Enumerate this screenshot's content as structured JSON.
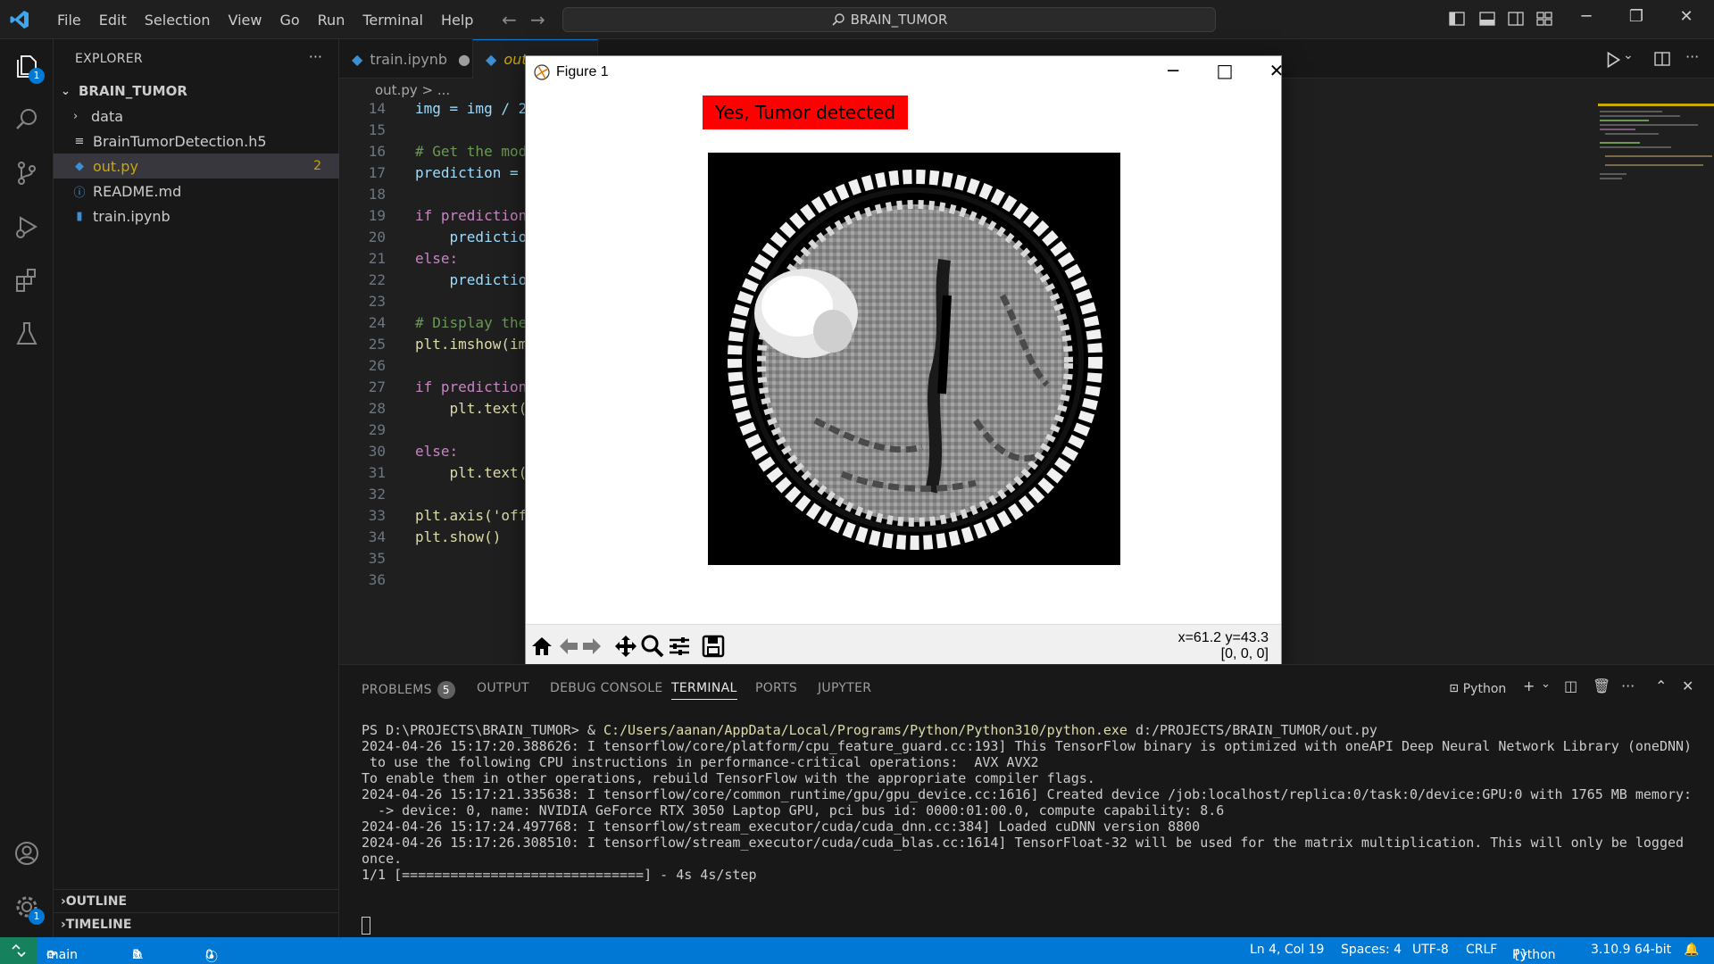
{
  "titlebar": {
    "menu": [
      "File",
      "Edit",
      "Selection",
      "View",
      "Go",
      "Run",
      "Terminal",
      "Help"
    ],
    "search_text": "BRAIN_TUMOR"
  },
  "activity": {
    "explorer_badge": "1",
    "settings_badge": "1"
  },
  "explorer": {
    "header": "EXPLORER",
    "more": "···",
    "root": "BRAIN_TUMOR",
    "items": [
      {
        "label": "data",
        "icon": "folder-chevron-icon"
      },
      {
        "label": "BrainTumorDetection.h5",
        "icon": "file-lines-icon"
      },
      {
        "label": "out.py",
        "icon": "python-icon",
        "problems": "2"
      },
      {
        "label": "README.md",
        "icon": "info-icon"
      },
      {
        "label": "train.ipynb",
        "icon": "notebook-icon"
      }
    ],
    "outline": "OUTLINE",
    "timeline": "TIMELINE"
  },
  "editor": {
    "tabs": [
      {
        "label": "train.ipynb"
      },
      {
        "label": "out.py"
      }
    ],
    "breadcrumb": "out.py > ...",
    "lines": [
      {
        "n": "14",
        "code": "img = img / 2"
      },
      {
        "n": "15",
        "code": ""
      },
      {
        "n": "16",
        "code": "# Get the mod"
      },
      {
        "n": "17",
        "code": "prediction = "
      },
      {
        "n": "18",
        "code": ""
      },
      {
        "n": "19",
        "code": "if prediction"
      },
      {
        "n": "20",
        "code": "    predictio"
      },
      {
        "n": "21",
        "code": "else:"
      },
      {
        "n": "22",
        "code": "    predictio"
      },
      {
        "n": "23",
        "code": ""
      },
      {
        "n": "24",
        "code": "# Display the"
      },
      {
        "n": "25",
        "code": "plt.imshow(im"
      },
      {
        "n": "26",
        "code": ""
      },
      {
        "n": "27",
        "code": "if prediction"
      },
      {
        "n": "28",
        "code": "    plt.text("
      },
      {
        "n": "29",
        "code": ""
      },
      {
        "n": "30",
        "code": "else:"
      },
      {
        "n": "31",
        "code": "    plt.text("
      },
      {
        "n": "32",
        "code": ""
      },
      {
        "n": "33",
        "code": "plt.axis('off"
      },
      {
        "n": "34",
        "code": "plt.show()"
      },
      {
        "n": "35",
        "code": ""
      },
      {
        "n": "36",
        "code": ""
      }
    ]
  },
  "figure": {
    "title": "Figure 1",
    "prediction_label": "Yes, Tumor detected",
    "coords_xy": "x=61.2 y=43.3",
    "coords_value": "[0, 0, 0]",
    "colors": {
      "label_bg": "#ff0000"
    }
  },
  "panel": {
    "tabs": [
      "PROBLEMS",
      "OUTPUT",
      "DEBUG CONSOLE",
      "TERMINAL",
      "PORTS",
      "JUPYTER"
    ],
    "problems_count": "5",
    "active_tab": "TERMINAL",
    "shell": "Python",
    "terminal": {
      "prompt": "PS D:\\PROJECTS\\BRAIN_TUMOR> & ",
      "exe": "C:/Users/aanan/AppData/Local/Programs/Python/Python310/python.exe",
      "script": " d:/PROJECTS/BRAIN_TUMOR/out.py",
      "lines": [
        "2024-04-26 15:17:20.388626: I tensorflow/core/platform/cpu_feature_guard.cc:193] This TensorFlow binary is optimized with oneAPI Deep Neural Network Library (oneDNN)",
        " to use the following CPU instructions in performance-critical operations:  AVX AVX2",
        "To enable them in other operations, rebuild TensorFlow with the appropriate compiler flags.",
        "2024-04-26 15:17:21.335638: I tensorflow/core/common_runtime/gpu/gpu_device.cc:1616] Created device /job:localhost/replica:0/task:0/device:GPU:0 with 1765 MB memory:",
        "  -> device: 0, name: NVIDIA GeForce RTX 3050 Laptop GPU, pci bus id: 0000:01:00.0, compute capability: 8.6",
        "2024-04-26 15:17:24.497768: I tensorflow/stream_executor/cuda/cuda_dnn.cc:384] Loaded cuDNN version 8800",
        "2024-04-26 15:17:26.308510: I tensorflow/stream_executor/cuda/cuda_blas.cc:1614] TensorFloat-32 will be used for the matrix multiplication. This will only be logged",
        "once.",
        "1/1 [==============================] - 4s 4s/step"
      ]
    }
  },
  "statusbar": {
    "branch": "main",
    "errors": "0",
    "warnings": "5",
    "ports": "0",
    "position": "Ln 4, Col 19",
    "spaces": "Spaces: 4",
    "encoding": "UTF-8",
    "eol": "CRLF",
    "language": "Python",
    "interpreter": "3.10.9 64-bit",
    "colors": {
      "bg": "#0078d4",
      "remote": "#16825d"
    }
  }
}
